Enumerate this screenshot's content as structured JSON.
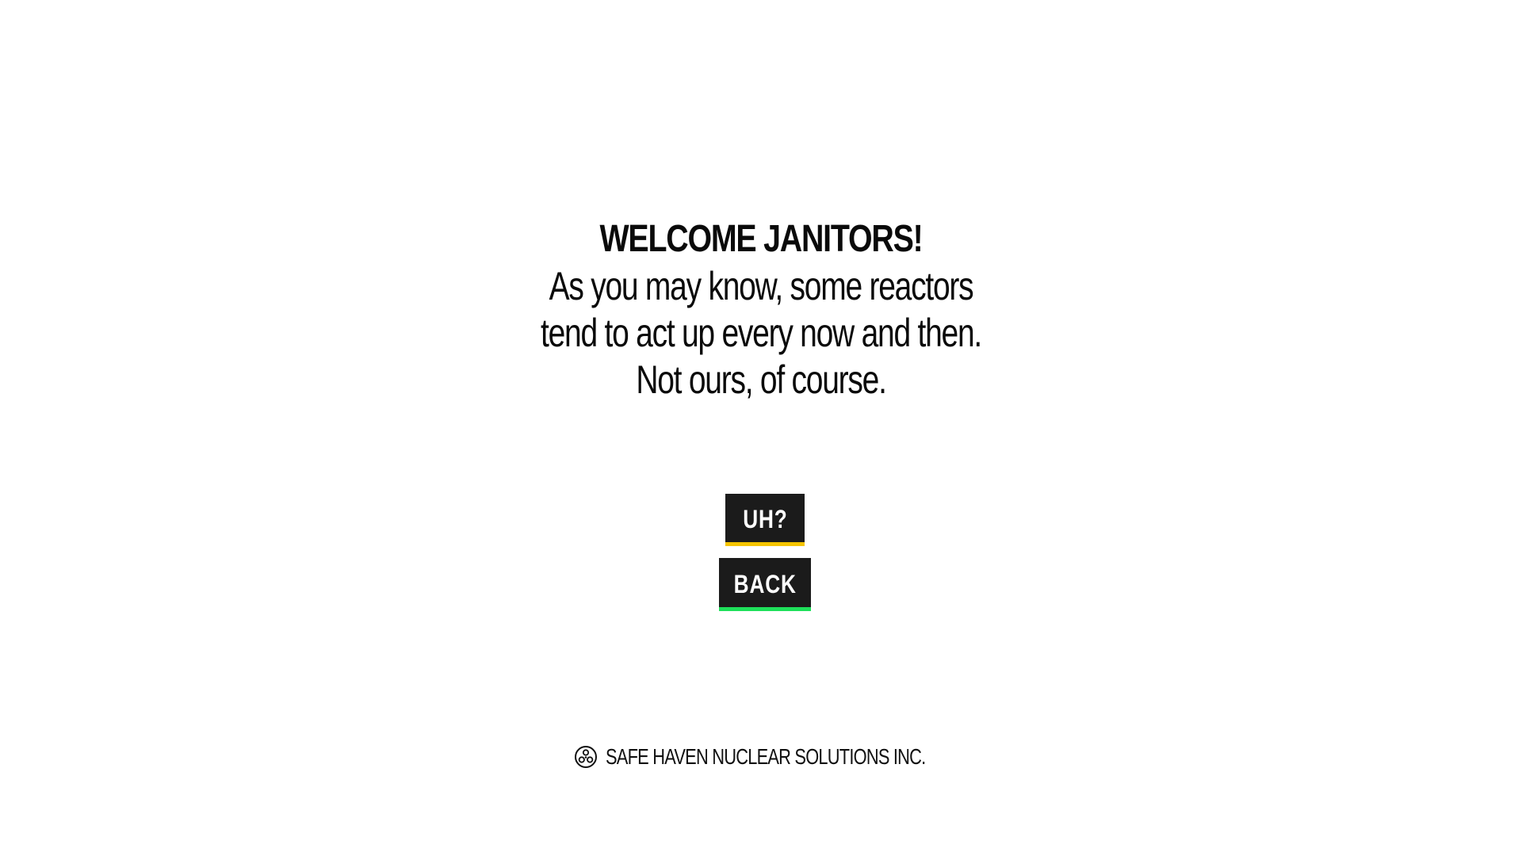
{
  "intro": {
    "title": "WELCOME JANITORS!",
    "lines": [
      "As you may know, some reactors",
      "tend to act up every now and then.",
      "Not ours, of course."
    ]
  },
  "buttons": {
    "uh_label": "UH?",
    "uh_accent": "#f5c400",
    "back_label": "BACK",
    "back_accent": "#1ee05a"
  },
  "footer": {
    "logo_icon": "radiation-logo-icon",
    "company": "SAFE HAVEN NUCLEAR SOLUTIONS INC."
  }
}
